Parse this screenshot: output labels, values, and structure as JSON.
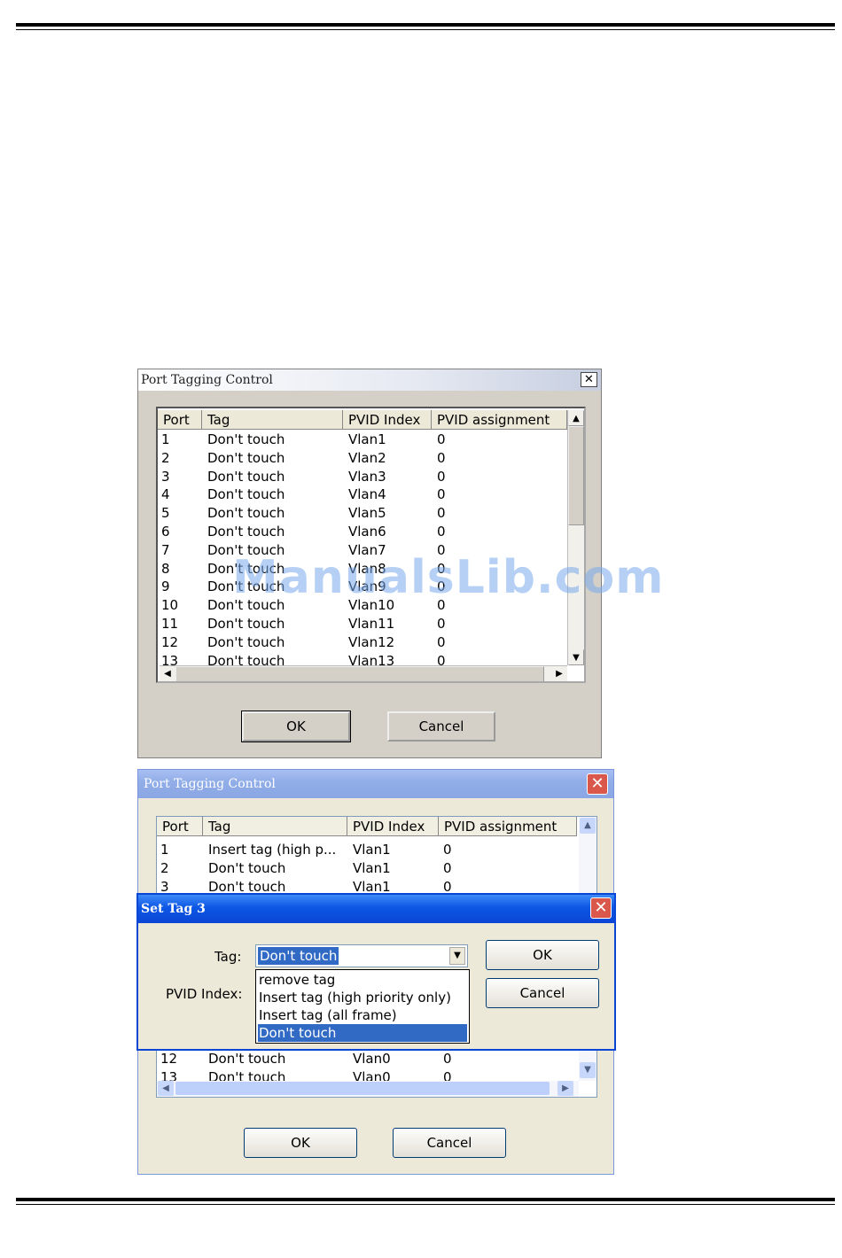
{
  "dialog1": {
    "title": "Port Tagging Control",
    "close": "✕",
    "columns": [
      "Port",
      "Tag",
      "PVID Index",
      "PVID assignment"
    ],
    "rows": [
      [
        "1",
        "Don't touch",
        "Vlan1",
        "0"
      ],
      [
        "2",
        "Don't touch",
        "Vlan2",
        "0"
      ],
      [
        "3",
        "Don't touch",
        "Vlan3",
        "0"
      ],
      [
        "4",
        "Don't touch",
        "Vlan4",
        "0"
      ],
      [
        "5",
        "Don't touch",
        "Vlan5",
        "0"
      ],
      [
        "6",
        "Don't touch",
        "Vlan6",
        "0"
      ],
      [
        "7",
        "Don't touch",
        "Vlan7",
        "0"
      ],
      [
        "8",
        "Don't touch",
        "Vlan8",
        "0"
      ],
      [
        "9",
        "Don't touch",
        "Vlan9",
        "0"
      ],
      [
        "10",
        "Don't touch",
        "Vlan10",
        "0"
      ],
      [
        "11",
        "Don't touch",
        "Vlan11",
        "0"
      ],
      [
        "12",
        "Don't touch",
        "Vlan12",
        "0"
      ],
      [
        "13",
        "Don't touch",
        "Vlan13",
        "0"
      ]
    ],
    "ok_label": "OK",
    "cancel_label": "Cancel"
  },
  "dialog2": {
    "title": "Port Tagging Control",
    "columns": [
      "Port",
      "Tag",
      "PVID Index",
      "PVID assignment"
    ],
    "rows_top": [
      [
        "1",
        "Insert tag (high p...",
        "Vlan1",
        "0"
      ],
      [
        "2",
        "Don't touch",
        "Vlan1",
        "0"
      ],
      [
        "3",
        "Don't touch",
        "Vlan1",
        "0"
      ]
    ],
    "rows_bottom": [
      [
        "12",
        "Don't touch",
        "Vlan0",
        "0"
      ],
      [
        "13",
        "Don't touch",
        "Vlan0",
        "0"
      ]
    ],
    "ok_label": "OK",
    "cancel_label": "Cancel"
  },
  "set_tag": {
    "title": "Set Tag 3",
    "tag_label": "Tag:",
    "pvid_label": "PVID Index:",
    "selected": "Don't touch",
    "options": [
      "remove tag",
      "Insert tag (high priority only)",
      "Insert tag (all frame)",
      "Don't touch"
    ],
    "ok_label": "OK",
    "cancel_label": "Cancel"
  },
  "watermark": "ManualsLib.com",
  "colors": {
    "xp_blue": "#0a46d6",
    "selection": "#316ac5",
    "classic_face": "#d4d0c8"
  }
}
